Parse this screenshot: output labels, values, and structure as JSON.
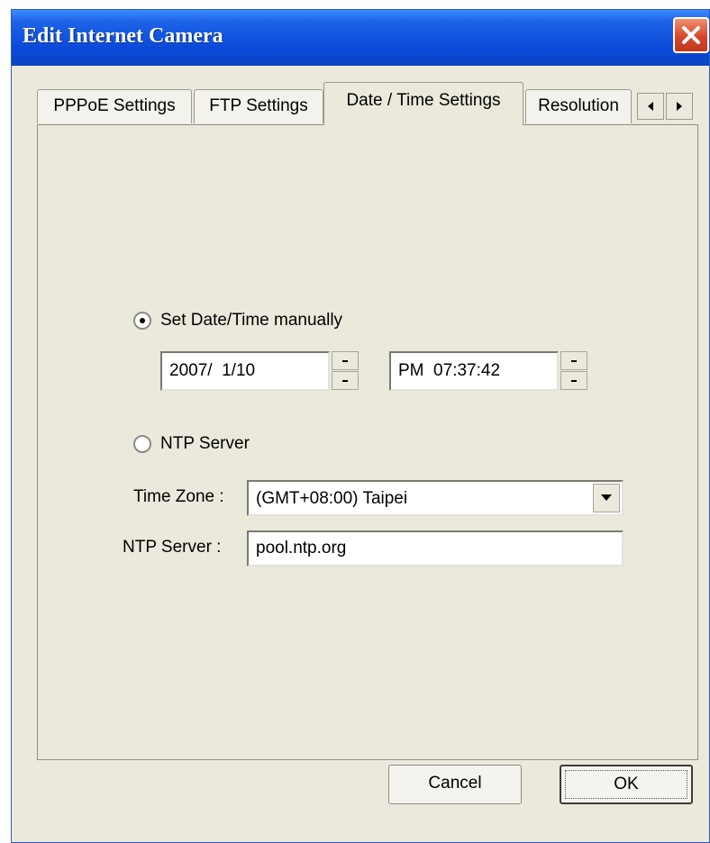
{
  "window": {
    "title": "Edit Internet Camera"
  },
  "tabs": [
    {
      "label": "PPPoE Settings"
    },
    {
      "label": "FTP Settings"
    },
    {
      "label": "Date / Time Settings",
      "active": true
    },
    {
      "label": "Resolution"
    }
  ],
  "datetime": {
    "manual_label": "Set Date/Time manually",
    "manual_selected": true,
    "date_value": "2007/  1/10",
    "time_value": "PM  07:37:42",
    "ntp_label": "NTP Server",
    "ntp_selected": false
  },
  "timezone": {
    "label": "Time Zone :",
    "value": "(GMT+08:00) Taipei"
  },
  "ntp_server": {
    "label": "NTP Server :",
    "value": "pool.ntp.org"
  },
  "buttons": {
    "cancel": "Cancel",
    "ok": "OK"
  },
  "icons": {
    "close": "close-icon",
    "tab_left": "arrow-left-icon",
    "tab_right": "arrow-right-icon",
    "spin_up": "spin-up-icon",
    "spin_down": "spin-down-icon",
    "dropdown": "chevron-down-icon"
  },
  "colors": {
    "titlebar": "#0a49d8",
    "dialog_bg": "#ebe9dc",
    "close": "#d6472a"
  }
}
